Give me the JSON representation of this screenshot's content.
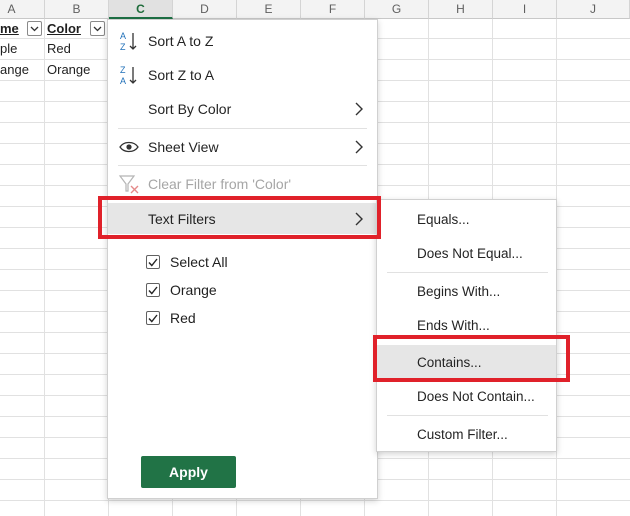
{
  "sheet": {
    "columns": [
      "A",
      "B",
      "C",
      "D",
      "E",
      "F",
      "G",
      "H",
      "I",
      "J"
    ],
    "selected_column": "C",
    "header_row": [
      "me",
      "Color"
    ],
    "rows": [
      [
        "ple",
        "Red"
      ],
      [
        "ange",
        "Orange"
      ]
    ]
  },
  "menu": {
    "sort_az": "Sort A to Z",
    "sort_za": "Sort Z to A",
    "sort_by_color": "Sort By Color",
    "sheet_view": "Sheet View",
    "clear_filter": "Clear Filter from 'Color'",
    "text_filters": "Text Filters",
    "checklist": [
      {
        "label": "Select All",
        "checked": true
      },
      {
        "label": "Orange",
        "checked": true
      },
      {
        "label": "Red",
        "checked": true
      }
    ],
    "apply": "Apply"
  },
  "submenu": {
    "items": [
      {
        "label": "Equals..."
      },
      {
        "label": "Does Not Equal..."
      },
      {
        "label": "Begins With..."
      },
      {
        "label": "Ends With..."
      },
      {
        "label": "Contains..."
      },
      {
        "label": "Does Not Contain..."
      },
      {
        "label": "Custom Filter..."
      }
    ]
  },
  "colors": {
    "accent_green": "#217346",
    "highlight_red": "#e0212a",
    "hover_gray": "#e6e6e6"
  },
  "icons": {
    "sort_az": "sort-ascending-icon",
    "sort_za": "sort-descending-icon",
    "sheet_view": "eye-icon",
    "clear_filter": "clear-filter-icon",
    "submenu": "chevron-right-icon",
    "checkbox": "checkmark-icon"
  }
}
